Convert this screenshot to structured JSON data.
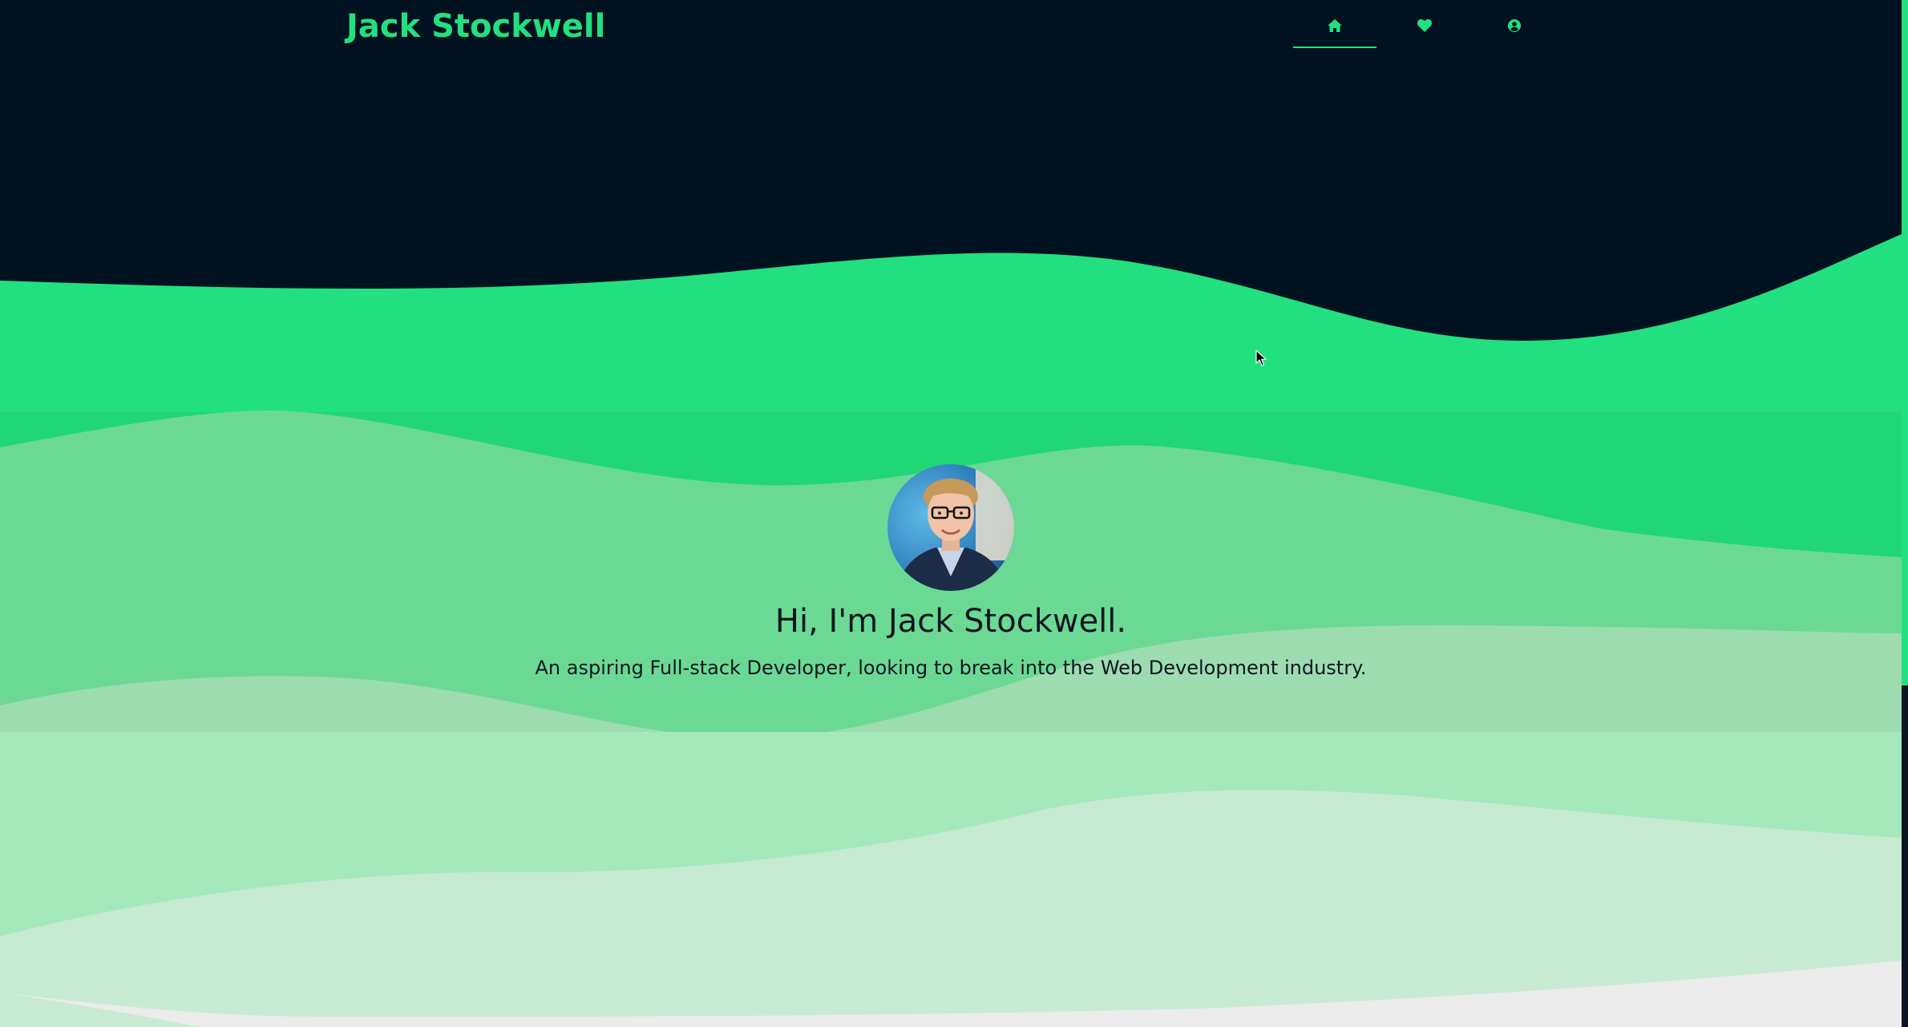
{
  "header": {
    "brand": "Jack Stockwell",
    "nav": [
      {
        "icon": "home-icon",
        "active": true
      },
      {
        "icon": "heart-icon",
        "active": false
      },
      {
        "icon": "user-circle-icon",
        "active": false
      }
    ]
  },
  "hero": {
    "avatar_alt": "avatar",
    "title": "Hi, I'm Jack Stockwell.",
    "subtitle": "An aspiring Full-stack Developer, looking to break into the Web Development industry."
  },
  "colors": {
    "navy": "#001220",
    "accent": "#22e07f",
    "wave2": "#21d677",
    "wave3": "#6bd994",
    "wave4": "#9ddcb1",
    "wave5": "#a5e8bb",
    "wave6": "#c7ead3",
    "bottom": "#ebebeb"
  }
}
